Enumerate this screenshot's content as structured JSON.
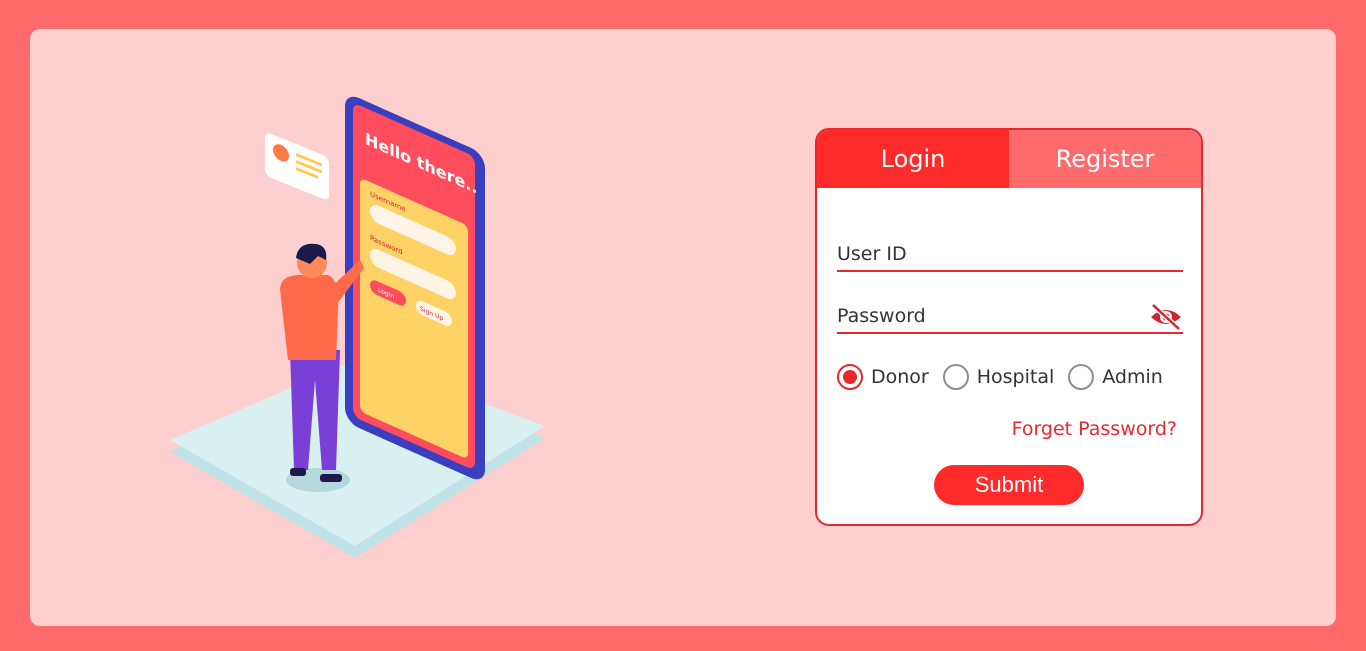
{
  "tabs": [
    {
      "label": "Login",
      "active": true
    },
    {
      "label": "Register",
      "active": false
    }
  ],
  "form": {
    "user_id_placeholder": "User ID",
    "password_placeholder": "Password",
    "password_toggle_icon": "eye-slash-icon",
    "roles": [
      {
        "label": "Donor",
        "checked": true
      },
      {
        "label": "Hospital",
        "checked": false
      },
      {
        "label": "Admin",
        "checked": false
      }
    ],
    "forgot_link": "Forget Password?",
    "submit_label": "Submit"
  },
  "illustration": {
    "greeting": "Hello there..",
    "username_label": "Username",
    "password_label": "Password",
    "login_btn": "Login",
    "signup_btn": "Sign Up"
  },
  "colors": {
    "page_bg": "#ff6b6b",
    "panel_bg": "#fdcfcf",
    "accent": "#ff2a2a",
    "border": "#e8272f"
  }
}
